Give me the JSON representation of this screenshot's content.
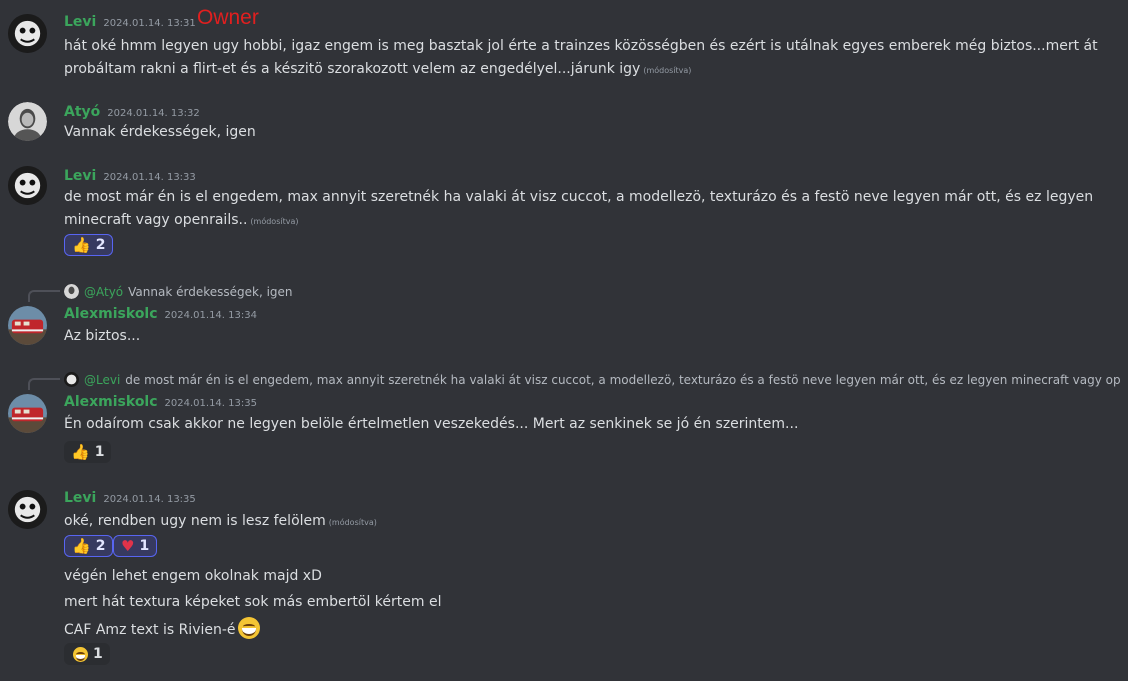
{
  "edited_label": "(módosítva)",
  "messages": [
    {
      "author": "Levi",
      "time": "2024.01.14. 13:31",
      "tag": "Owner",
      "text": "hát oké hmm legyen ugy hobbi, igaz engem is meg basztak jol érte a trainzes közösségben és ezért is utálnak egyes emberek még biztos...mert át probáltam rakni a flirt-et és a készitö szorakozott velem az engedélyel...járunk igy"
    },
    {
      "author": "Atyó",
      "time": "2024.01.14. 13:32",
      "text": "Vannak érdekességek, igen"
    },
    {
      "author": "Levi",
      "time": "2024.01.14. 13:33",
      "text": "de most már én is el engedem, max annyit szeretnék ha valaki át visz cuccot, a modellezö, texturázo és a festö neve legyen már ott, és ez legyen minecraft vagy openrails..",
      "reactions": [
        {
          "icon": "thumbs-up",
          "count": "2"
        }
      ]
    },
    {
      "reply_to": {
        "author": "@Atyó",
        "text": "Vannak érdekességek, igen"
      },
      "author": "Alexmiskolc",
      "time": "2024.01.14. 13:34",
      "text": "Az biztos..."
    },
    {
      "reply_to": {
        "author": "@Levi",
        "text": "de most már én is el engedem, max annyit szeretnék ha valaki át visz cuccot, a modellezö, texturázo és a festö neve legyen már ott, és ez legyen minecraft vagy openrails.."
      },
      "author": "Alexmiskolc",
      "time": "2024.01.14. 13:35",
      "text": "Én odaírom csak akkor ne legyen belöle értelmetlen veszekedés... Mert az senkinek se jó én szerintem...",
      "reactions": [
        {
          "icon": "thumbs-up",
          "count": "1"
        }
      ]
    },
    {
      "author": "Levi",
      "time": "2024.01.14. 13:35",
      "text": "oké, rendben ugy nem is lesz felölem",
      "reactions": [
        {
          "icon": "thumbs-up",
          "count": "2"
        },
        {
          "icon": "heart",
          "count": "1"
        }
      ],
      "followups": [
        "végén lehet engem okolnak majd xD",
        "mert hát textura képeket sok más embertöl kértem el",
        "CAF Amz text is Rivien-é"
      ],
      "followup_reaction": {
        "icon": "grinning-face",
        "count": "1"
      }
    }
  ],
  "colors": {
    "background": "#313338",
    "username": "#3ba55c",
    "owner_tag": "#e11f1f",
    "reaction_active_border": "#5865f2"
  }
}
